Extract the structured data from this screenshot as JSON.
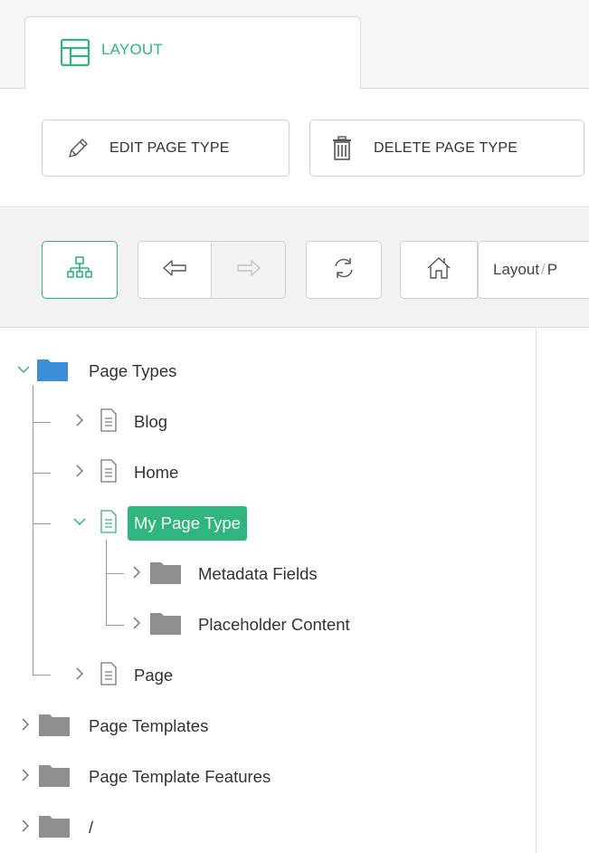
{
  "tab": {
    "label": "LAYOUT",
    "icon": "layout-icon"
  },
  "actions": {
    "edit_label": "EDIT PAGE TYPE",
    "delete_label": "DELETE PAGE TYPE"
  },
  "breadcrumb": {
    "first": "Layout",
    "separator": "/",
    "second": "P"
  },
  "tree": {
    "root": {
      "label": "Page Types"
    },
    "children": [
      {
        "label": "Blog"
      },
      {
        "label": "Home"
      },
      {
        "label": "My Page Type",
        "selected": true
      },
      {
        "label": "Page"
      }
    ],
    "selected_children": [
      {
        "label": "Metadata Fields"
      },
      {
        "label": "Placeholder Content"
      }
    ],
    "other_roots": [
      {
        "label": "Page Templates"
      },
      {
        "label": "Page Template Features"
      },
      {
        "label": "/"
      }
    ]
  },
  "colors": {
    "accent": "#2fb57e",
    "folder_blue": "#3d8ed8",
    "folder_gray": "#8f8f8f"
  }
}
